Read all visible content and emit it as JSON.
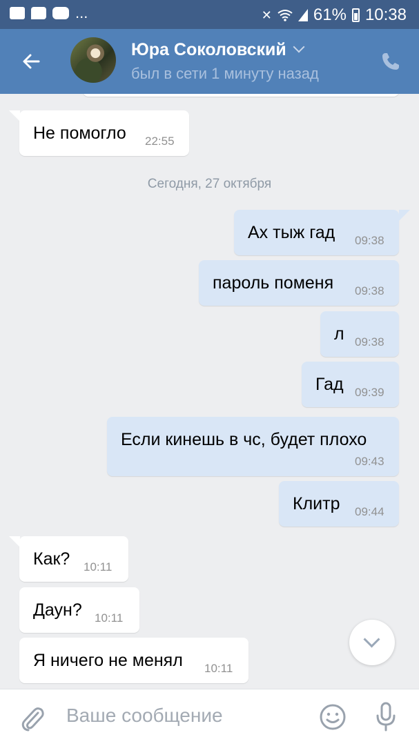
{
  "status_bar": {
    "battery": "61%",
    "time": "10:38",
    "dots": "..."
  },
  "header": {
    "contact_name": "Юра Соколовский",
    "last_seen": "был в сети 1 минуту назад"
  },
  "date_separator": "Сегодня, 27 октября",
  "messages": [
    {
      "dir": "in",
      "text": "Не помогло",
      "time": "22:55"
    },
    {
      "dir": "out",
      "text": "Ах тыж гад",
      "time": "09:38"
    },
    {
      "dir": "out",
      "text": "пароль поменя",
      "time": "09:38"
    },
    {
      "dir": "out",
      "text": "л",
      "time": "09:38"
    },
    {
      "dir": "out",
      "text": "Гад",
      "time": "09:39"
    },
    {
      "dir": "out",
      "text": "Если кинешь в чс, будет плохо",
      "time": "09:43"
    },
    {
      "dir": "out",
      "text": "Клитр",
      "time": "09:44"
    },
    {
      "dir": "in",
      "text": "Как?",
      "time": "10:11"
    },
    {
      "dir": "in",
      "text": "Даун?",
      "time": "10:11"
    },
    {
      "dir": "in",
      "text": "Я ничего не менял",
      "time": "10:11"
    }
  ],
  "input": {
    "placeholder": "Ваше сообщение"
  },
  "icons": [
    "image-icon",
    "chat-icon",
    "youtube-icon",
    "mute-icon",
    "wifi-icon",
    "signal-icon",
    "battery-icon",
    "back-arrow-icon",
    "chevron-down-icon",
    "phone-icon",
    "scroll-down-icon",
    "attach-icon",
    "emoji-icon",
    "microphone-icon"
  ],
  "colors": {
    "status_bar": "#3f5e89",
    "header": "#5181b8",
    "background": "#edeef0",
    "outgoing_bubble": "#d9e6f6",
    "incoming_bubble": "#ffffff"
  }
}
